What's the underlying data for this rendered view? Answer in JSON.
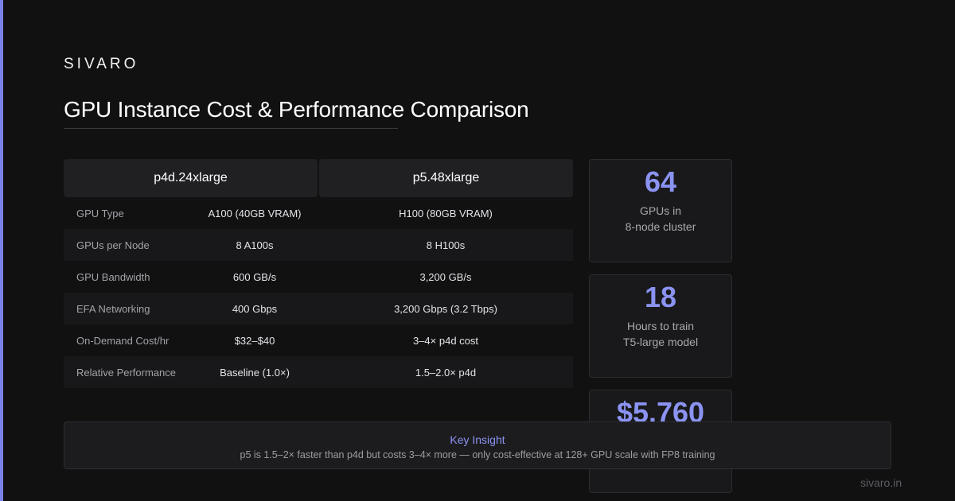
{
  "brand": "SIVARO",
  "title": "GPU Instance Cost & Performance Comparison",
  "table": {
    "headers": [
      "p4d.24xlarge",
      "p5.48xlarge"
    ],
    "rows": [
      {
        "label": "GPU Type",
        "p4d": "A100 (40GB VRAM)",
        "p5": "H100 (80GB VRAM)"
      },
      {
        "label": "GPUs per Node",
        "p4d": "8 A100s",
        "p5": "8 H100s"
      },
      {
        "label": "GPU Bandwidth",
        "p4d": "600 GB/s",
        "p5": "3,200 GB/s"
      },
      {
        "label": "EFA Networking",
        "p4d": "400 Gbps",
        "p5": "3,200 Gbps (3.2 Tbps)"
      },
      {
        "label": "On-Demand Cost/hr",
        "p4d": "$32–$40",
        "p5": "3–4× p4d cost"
      },
      {
        "label": "Relative Performance",
        "p4d": "Baseline (1.0×)",
        "p5": "1.5–2.0× p4d"
      }
    ]
  },
  "stats": [
    {
      "value": "64",
      "caption_line1": "GPUs in",
      "caption_line2": "8-node cluster"
    },
    {
      "value": "18",
      "caption_line1": "Hours to train",
      "caption_line2": "T5-large model"
    },
    {
      "value": "$5.760",
      "caption_line1": "",
      "caption_line2": ""
    }
  ],
  "insight": {
    "heading": "Key Insight",
    "text": "p5 is 1.5–2× faster than p4d but costs 3–4× more — only cost-effective at 128+ GPU scale with FP8 training"
  },
  "footer": "sivaro.in",
  "colors": {
    "accent": "#7b83eb",
    "stat_value": "#8b93f2",
    "background": "#111112"
  }
}
